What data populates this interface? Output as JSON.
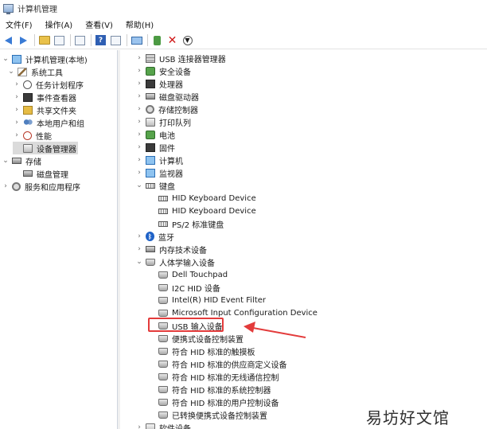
{
  "window": {
    "title": "计算机管理"
  },
  "menu": [
    "文件(F)",
    "操作(A)",
    "查看(V)",
    "帮助(H)"
  ],
  "left_tree": [
    {
      "label": "计算机管理(本地)",
      "icon": "computer-management-icon",
      "level": 0,
      "expander": "open"
    },
    {
      "label": "系统工具",
      "icon": "system-tools-icon",
      "level": 1,
      "expander": "open"
    },
    {
      "label": "任务计划程序",
      "icon": "clock-icon",
      "level": 2,
      "expander": "closed"
    },
    {
      "label": "事件查看器",
      "icon": "event-viewer-icon",
      "level": 2,
      "expander": "closed"
    },
    {
      "label": "共享文件夹",
      "icon": "shared-folder-icon",
      "level": 2,
      "expander": "closed"
    },
    {
      "label": "本地用户和组",
      "icon": "users-icon",
      "level": 2,
      "expander": "closed"
    },
    {
      "label": "性能",
      "icon": "performance-icon",
      "level": 2,
      "expander": "closed"
    },
    {
      "label": "设备管理器",
      "icon": "device-manager-icon",
      "level": 2,
      "expander": "none",
      "selected": true
    },
    {
      "label": "存储",
      "icon": "storage-icon",
      "level": 0,
      "expander": "open"
    },
    {
      "label": "磁盘管理",
      "icon": "disk-icon",
      "level": 2,
      "expander": "none"
    },
    {
      "label": "服务和应用程序",
      "icon": "services-icon",
      "level": 0,
      "expander": "closed"
    }
  ],
  "device_tree": [
    {
      "label": "USB 连接器管理器",
      "icon": "usb-connector-icon",
      "level": 0,
      "expander": "closed"
    },
    {
      "label": "安全设备",
      "icon": "security-device-icon",
      "level": 0,
      "expander": "closed"
    },
    {
      "label": "处理器",
      "icon": "processor-icon",
      "level": 0,
      "expander": "closed"
    },
    {
      "label": "磁盘驱动器",
      "icon": "disk-drive-icon",
      "level": 0,
      "expander": "closed"
    },
    {
      "label": "存储控制器",
      "icon": "storage-controller-icon",
      "level": 0,
      "expander": "closed"
    },
    {
      "label": "打印队列",
      "icon": "printer-icon",
      "level": 0,
      "expander": "closed"
    },
    {
      "label": "电池",
      "icon": "battery-icon",
      "level": 0,
      "expander": "closed"
    },
    {
      "label": "固件",
      "icon": "firmware-icon",
      "level": 0,
      "expander": "closed"
    },
    {
      "label": "计算机",
      "icon": "computer-icon",
      "level": 0,
      "expander": "closed"
    },
    {
      "label": "监视器",
      "icon": "monitor-icon",
      "level": 0,
      "expander": "closed"
    },
    {
      "label": "键盘",
      "icon": "keyboard-icon",
      "level": 0,
      "expander": "open"
    },
    {
      "label": "HID Keyboard Device",
      "icon": "keyboard-icon",
      "level": 1,
      "expander": "none"
    },
    {
      "label": "HID Keyboard Device",
      "icon": "keyboard-icon",
      "level": 1,
      "expander": "none"
    },
    {
      "label": "PS/2 标准键盘",
      "icon": "keyboard-icon",
      "level": 1,
      "expander": "none"
    },
    {
      "label": "蓝牙",
      "icon": "bluetooth-icon",
      "level": 0,
      "expander": "closed"
    },
    {
      "label": "内存技术设备",
      "icon": "memory-device-icon",
      "level": 0,
      "expander": "closed"
    },
    {
      "label": "人体学输入设备",
      "icon": "hid-icon",
      "level": 0,
      "expander": "open"
    },
    {
      "label": "Dell Touchpad",
      "icon": "hid-icon",
      "level": 1,
      "expander": "none"
    },
    {
      "label": "I2C HID 设备",
      "icon": "hid-icon",
      "level": 1,
      "expander": "none"
    },
    {
      "label": "Intel(R) HID Event Filter",
      "icon": "hid-icon",
      "level": 1,
      "expander": "none"
    },
    {
      "label": "Microsoft Input Configuration Device",
      "icon": "hid-icon",
      "level": 1,
      "expander": "none"
    },
    {
      "label": "USB 输入设备",
      "icon": "hid-icon",
      "level": 1,
      "expander": "none",
      "highlighted": true
    },
    {
      "label": "便携式设备控制装置",
      "icon": "hid-icon",
      "level": 1,
      "expander": "none"
    },
    {
      "label": "符合 HID 标准的触摸板",
      "icon": "hid-icon",
      "level": 1,
      "expander": "none"
    },
    {
      "label": "符合 HID 标准的供应商定义设备",
      "icon": "hid-icon",
      "level": 1,
      "expander": "none"
    },
    {
      "label": "符合 HID 标准的无线通信控制",
      "icon": "hid-icon",
      "level": 1,
      "expander": "none"
    },
    {
      "label": "符合 HID 标准的系统控制器",
      "icon": "hid-icon",
      "level": 1,
      "expander": "none"
    },
    {
      "label": "符合 HID 标准的用户控制设备",
      "icon": "hid-icon",
      "level": 1,
      "expander": "none"
    },
    {
      "label": "已转换便携式设备控制装置",
      "icon": "hid-icon",
      "level": 1,
      "expander": "none"
    },
    {
      "label": "软件设备",
      "icon": "software-device-icon",
      "level": 0,
      "expander": "closed"
    }
  ],
  "annotation": {
    "color": "#e33b3b"
  },
  "watermark": "易坊好文馆"
}
